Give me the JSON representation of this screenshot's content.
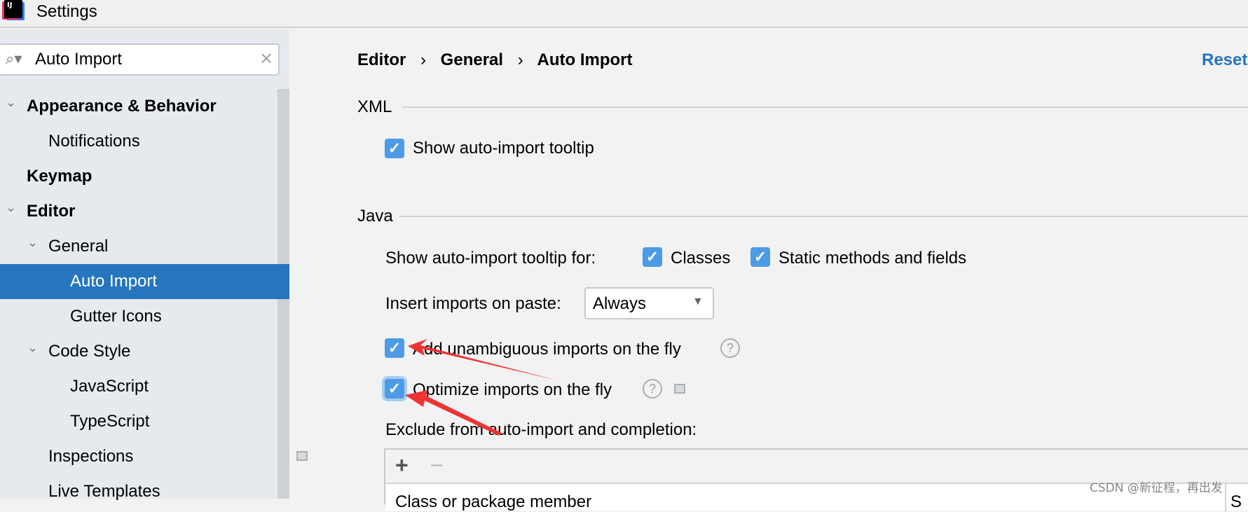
{
  "window": {
    "title": "Settings",
    "logo": "IJ"
  },
  "search": {
    "value": "Auto Import",
    "icon": "search-icon"
  },
  "tree": [
    {
      "label": "Appearance & Behavior",
      "bold": true,
      "expanded": true
    },
    {
      "label": "Notifications"
    },
    {
      "label": "Keymap",
      "bold": true
    },
    {
      "label": "Editor",
      "bold": true,
      "expanded": true
    },
    {
      "label": "General",
      "expanded": true
    },
    {
      "label": "Auto Import",
      "selected": true
    },
    {
      "label": "Gutter Icons"
    },
    {
      "label": "Code Style",
      "expanded": true
    },
    {
      "label": "JavaScript"
    },
    {
      "label": "TypeScript"
    },
    {
      "label": "Inspections"
    },
    {
      "label": "Live Templates"
    }
  ],
  "breadcrumb": [
    "Editor",
    "General",
    "Auto Import"
  ],
  "reset_label": "Reset",
  "xml": {
    "header": "XML",
    "show_tooltip": {
      "label": "Show auto-import tooltip",
      "checked": true
    }
  },
  "java": {
    "header": "Java",
    "tooltip_for_label": "Show auto-import tooltip for:",
    "classes": {
      "label": "Classes",
      "checked": true
    },
    "static": {
      "label": "Static methods and fields",
      "checked": true
    },
    "paste_label": "Insert imports on paste:",
    "paste_value": "Always",
    "add_unambiguous": {
      "label": "Add unambiguous imports on the fly",
      "checked": true
    },
    "optimize": {
      "label": "Optimize imports on the fly",
      "checked": true
    },
    "exclude_label": "Exclude from auto-import and completion:",
    "table_header": "Class or package member",
    "table_header2": "S"
  },
  "watermark": "CSDN @新征程，再出发",
  "colors": {
    "accent": "#2675bf",
    "checkbox": "#4d9be6",
    "arrow": "#ee3333"
  }
}
